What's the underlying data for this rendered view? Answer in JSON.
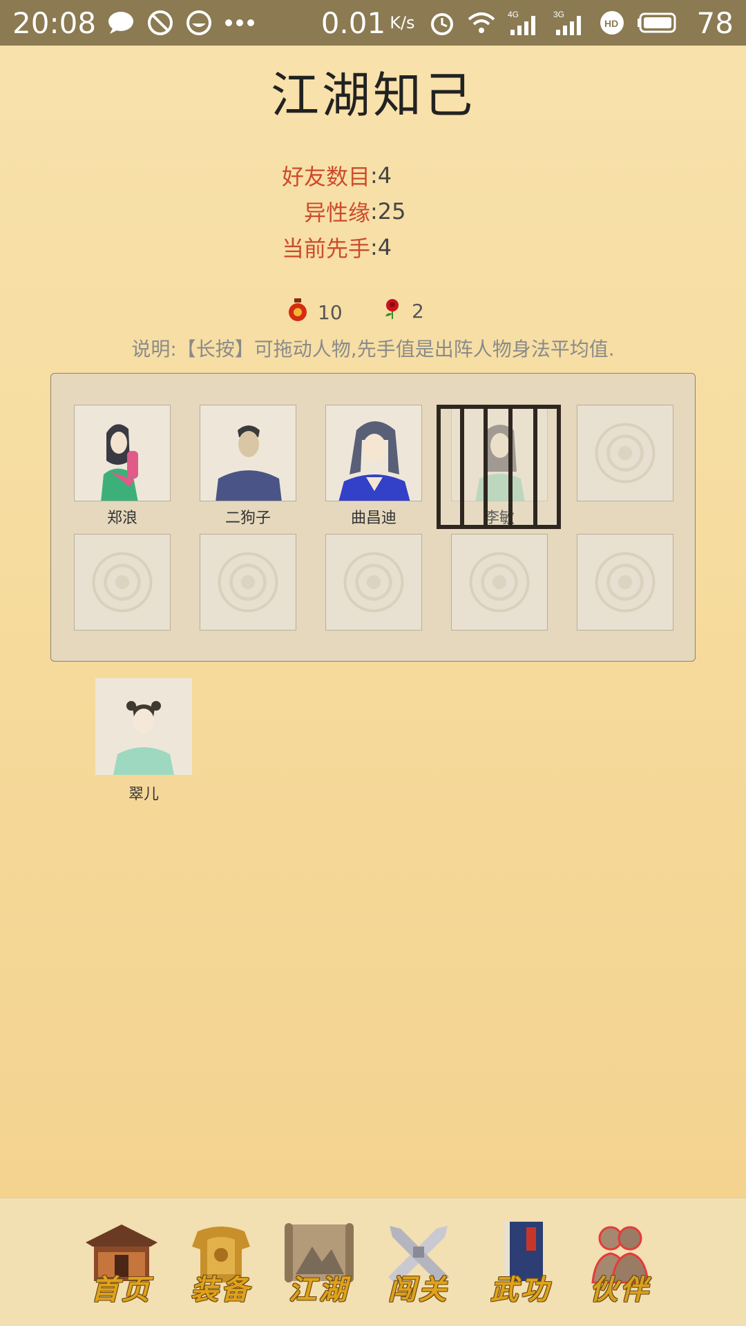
{
  "status_bar": {
    "time": "20:08",
    "speed": "0.01",
    "speed_unit": "K/s",
    "network_4g": "4G",
    "network_3g": "3G",
    "hd": "HD",
    "battery": "78"
  },
  "page": {
    "title": "江湖知己"
  },
  "stats": [
    {
      "label": "好友数目",
      "value": "4"
    },
    {
      "label": "异性缘",
      "value": "25"
    },
    {
      "label": "当前先手",
      "value": "4"
    }
  ],
  "items": [
    {
      "name": "wine-jar-icon",
      "count": "10"
    },
    {
      "name": "rose-icon",
      "count": "2"
    }
  ],
  "instruction": "说明:【长按】可拖动人物,先手值是出阵人物身法平均值.",
  "formation": [
    {
      "name": "郑浪",
      "portrait": "zheng-lang",
      "caged": false
    },
    {
      "name": "二狗子",
      "portrait": "er-gouzi",
      "caged": false
    },
    {
      "name": "曲昌迪",
      "portrait": "qu-changdi",
      "caged": false
    },
    {
      "name": "李敏",
      "portrait": "li-min",
      "caged": true
    },
    {
      "name": "",
      "portrait": "empty",
      "caged": false
    },
    {
      "name": "",
      "portrait": "empty",
      "caged": false
    },
    {
      "name": "",
      "portrait": "empty",
      "caged": false
    },
    {
      "name": "",
      "portrait": "empty",
      "caged": false
    },
    {
      "name": "",
      "portrait": "empty",
      "caged": false
    },
    {
      "name": "",
      "portrait": "empty",
      "caged": false
    }
  ],
  "reserve": [
    {
      "name": "翠儿",
      "portrait": "cui-er"
    }
  ],
  "nav": [
    {
      "label": "首页",
      "icon": "house-icon"
    },
    {
      "label": "装备",
      "icon": "armor-icon"
    },
    {
      "label": "江湖",
      "icon": "scroll-map-icon"
    },
    {
      "label": "闯关",
      "icon": "crossed-swords-icon"
    },
    {
      "label": "武功",
      "icon": "book-icon"
    },
    {
      "label": "伙伴",
      "icon": "companions-icon",
      "active": true
    }
  ],
  "colors": {
    "stat_label": "#cc4b2b",
    "nav_label": "#e0a21a",
    "status_bar": "#8b7a52"
  }
}
